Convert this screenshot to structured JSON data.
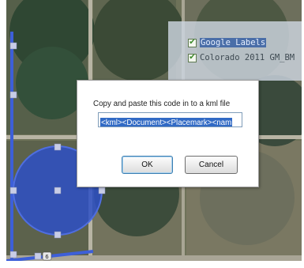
{
  "layers_panel": {
    "items": [
      {
        "label": "Google Labels",
        "checked": true,
        "selected": true
      },
      {
        "label": "Colorado 2011 GM_BM",
        "checked": true,
        "selected": false
      }
    ]
  },
  "dialog": {
    "prompt": "Copy and paste this code in to a kml file",
    "code_value": "<kml><Document><Placemark><nam",
    "ok_label": "OK",
    "cancel_label": "Cancel"
  },
  "map": {
    "road_shield": "6",
    "colors": {
      "field_dark": "#2f4733",
      "field_mid": "#4f5a44",
      "field_tan": "#7a7862",
      "road": "#b8b4a4",
      "polygon_fill": "#2d50c6",
      "polygon_stroke": "#4f6ee0",
      "vertex_handle": "#c8cde6"
    }
  }
}
